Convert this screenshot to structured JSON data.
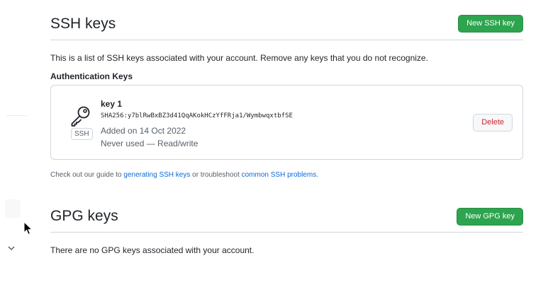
{
  "ssh": {
    "title": "SSH keys",
    "new_button": "New SSH key",
    "intro": "This is a list of SSH keys associated with your account. Remove any keys that you do not recognize.",
    "auth_heading": "Authentication Keys",
    "keys": [
      {
        "name": "key 1",
        "fingerprint": "SHA256:y7blRwBxBZ3d41QqAKokHCzYfFRja1/WymbwqxtbfSE",
        "badge": "SSH",
        "added": "Added on 14 Oct 2022",
        "usage": "Never used — Read/write",
        "delete_label": "Delete"
      }
    ],
    "guide": {
      "prefix": "Check out our guide to ",
      "link1": "generating SSH keys",
      "middle": " or troubleshoot ",
      "link2": "common SSH problems",
      "suffix": "."
    }
  },
  "gpg": {
    "title": "GPG keys",
    "new_button": "New GPG key",
    "empty": "There are no GPG keys associated with your account."
  }
}
